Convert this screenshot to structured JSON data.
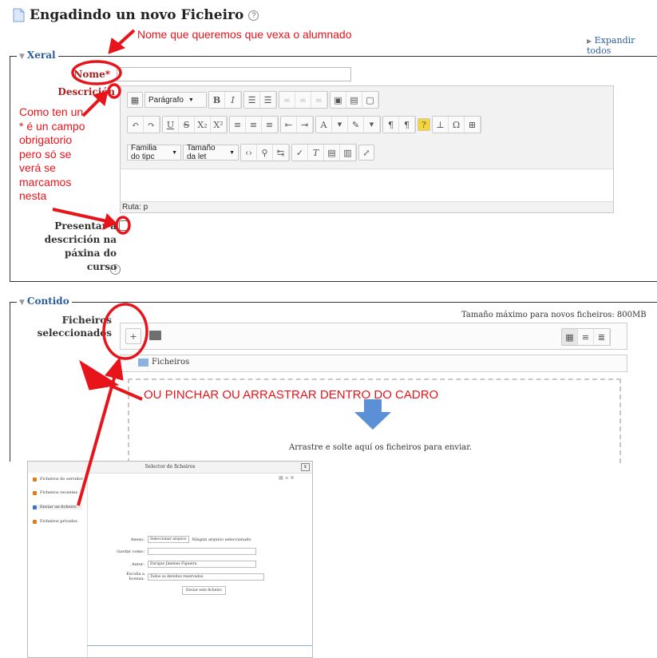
{
  "page": {
    "title": "Engadindo un novo Ficheiro",
    "help_glyph": "?",
    "expand_all": "Expandir todos"
  },
  "annotations": {
    "name_note": "Nome que queremos que vexa o alumnado",
    "required_note": [
      "Como ten un",
      "* é un campo",
      "obrigatorio",
      "pero só se",
      "verá se",
      "marcamos",
      "nesta"
    ],
    "drag_note": "OU PINCHAR OU ARRASTRAR DENTRO DO CADRO"
  },
  "general": {
    "legend": "Xeral",
    "name_label": "Nome",
    "required_mark": "*",
    "name_value": "",
    "description_label": "Descrición",
    "toolbar": {
      "paragraph": "Parágrafo",
      "font_family": "Familia do tipc",
      "font_size": "Tamaño da let"
    },
    "path_label": "Ruta: p",
    "show_description_label": [
      "Presentar a",
      "descrición na",
      "páxina do curso"
    ],
    "show_description_checked": false
  },
  "content": {
    "legend": "Contido",
    "selected_files_label": [
      "Ficheiros",
      "seleccionados"
    ],
    "max_size": "Tamaño máximo para novos ficheiros: 800MB",
    "folder_name": "Ficheiros",
    "drop_text": "Arrastre e solte aquí os ficheiros para enviar."
  },
  "dialog": {
    "title": "Selector de ficheiros",
    "close": "x",
    "sidebar": [
      {
        "label": "Ficheiros do servidor",
        "icon": "server-icon"
      },
      {
        "label": "Ficheiros recentes",
        "icon": "recent-icon"
      },
      {
        "label": "Enviar un ficheiro",
        "icon": "upload-icon"
      },
      {
        "label": "Ficheiros privados",
        "icon": "private-icon"
      }
    ],
    "form": {
      "attachment_label": "Anexo:",
      "choose_button": "Seleccionar arquivo",
      "no_file": "Ningún arquivo seleccionado",
      "save_as_label": "Gardar como:",
      "author_label": "Autor:",
      "author_value": "Enrique Jiménez Figueira",
      "license_label": "Escolla a licenza:",
      "license_value": "Todos os dereitos reservados",
      "upload_button": "Enviar este ficheiro"
    }
  },
  "colors": {
    "annotation_red": "#e8141b",
    "legend_blue": "#2b5d9c",
    "drop_arrow_blue": "#5b8fd6"
  }
}
